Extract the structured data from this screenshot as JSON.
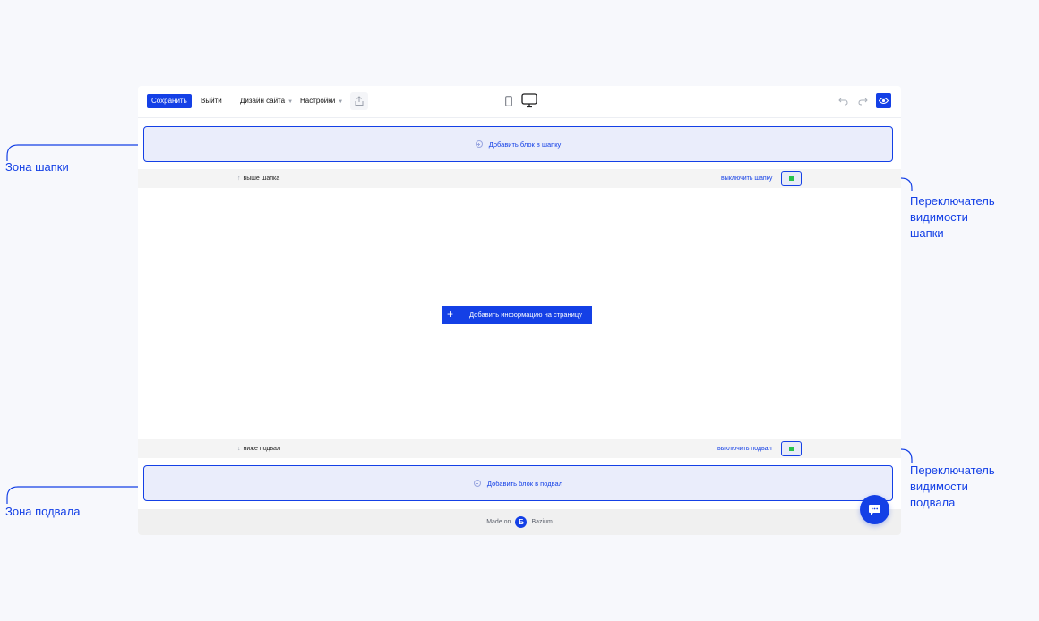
{
  "toolbar": {
    "save_label": "Сохранить",
    "exit_label": "Выйти",
    "design_label": "Дизайн сайта",
    "settings_label": "Настройки"
  },
  "header_zone": {
    "add_label": "Добавить блок в шапку"
  },
  "footer_zone": {
    "add_label": "Добавить блок в подвал"
  },
  "top_strip": {
    "label": "выше шапка",
    "toggle_link": "выключить шапку"
  },
  "bottom_strip": {
    "label": "ниже подвал",
    "toggle_link": "выключить подвал"
  },
  "content": {
    "add_info_label": "Добавить информацию на страницу"
  },
  "made_on": {
    "prefix": "Made on",
    "logo_letter": "Б",
    "brand": "Bazium"
  },
  "annotations": {
    "header_zone": "Зона шапки",
    "footer_zone": "Зона подвала",
    "header_toggle_line1": "Переключатель",
    "header_toggle_line2": "видимости",
    "header_toggle_line3": "шапки",
    "footer_toggle_line1": "Переключатель",
    "footer_toggle_line2": "видимости",
    "footer_toggle_line3": "подвала"
  },
  "colors": {
    "accent": "#1440e6",
    "toggle_on": "#27c24c",
    "zone_fill": "#eaedfb",
    "page_bg": "#f7f8fc"
  },
  "icons": [
    "share-icon",
    "mobile-view-icon",
    "desktop-view-icon",
    "undo-icon",
    "redo-icon",
    "preview-eye-icon",
    "chat-icon"
  ]
}
